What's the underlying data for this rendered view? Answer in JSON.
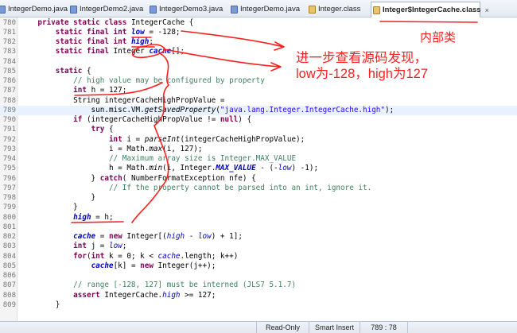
{
  "tabs": [
    {
      "label": "IntegerDemo.java",
      "type": "java",
      "active": false
    },
    {
      "label": "IntegerDemo2.java",
      "type": "java",
      "active": false
    },
    {
      "label": "IntegerDemo3.java",
      "type": "java",
      "active": false
    },
    {
      "label": "IntegerDemo.java",
      "type": "java",
      "active": false
    },
    {
      "label": "Integer.class",
      "type": "class",
      "active": false
    },
    {
      "label": "Integer$IntegerCache.class",
      "type": "class",
      "active": true
    }
  ],
  "tab_close_glyph": "×",
  "code_lines": [
    {
      "num": "780",
      "html": "    <span class=\"k\">private static class</span> IntegerCache {"
    },
    {
      "num": "781",
      "html": "        <span class=\"k\">static final int</span> <span class=\"fb\">low</span> = -128;"
    },
    {
      "num": "782",
      "html": "        <span class=\"k\">static final int</span> <span class=\"fb\">high</span>;"
    },
    {
      "num": "783",
      "html": "        <span class=\"k\">static final</span> Integer <span class=\"fb\">cache</span>[];"
    },
    {
      "num": "784",
      "html": ""
    },
    {
      "num": "785",
      "html": "        <span class=\"k\">static</span> {"
    },
    {
      "num": "786",
      "html": "            <span class=\"c\">// high value may be configured by property</span>"
    },
    {
      "num": "787",
      "html": "            <span class=\"k\">int</span> h = 127;"
    },
    {
      "num": "788",
      "html": "            String integerCacheHighPropValue ="
    },
    {
      "num": "789",
      "html": "                sun.misc.VM.<span class=\"i\">getSavedProperty</span>(<span class=\"s\">\"java.lang.Integer.IntegerCache.high\"</span>);",
      "highlight": true
    },
    {
      "num": "790",
      "html": "            <span class=\"k\">if</span> (integerCacheHighPropValue != <span class=\"k\">null</span>) {"
    },
    {
      "num": "791",
      "html": "                <span class=\"k\">try</span> {"
    },
    {
      "num": "792",
      "html": "                    <span class=\"k\">int</span> i = <span class=\"i\">parseInt</span>(integerCacheHighPropValue);"
    },
    {
      "num": "793",
      "html": "                    i = Math.<span class=\"i\">max</span>(i, 127);"
    },
    {
      "num": "794",
      "html": "                    <span class=\"c\">// Maximum array size is Integer.MAX_VALUE</span>"
    },
    {
      "num": "795",
      "html": "                    h = Math.<span class=\"i\">min</span>(i, Integer.<span class=\"fb\">MAX_VALUE</span> - (-<span class=\"fi\">low</span>) -1);"
    },
    {
      "num": "796",
      "html": "                } <span class=\"k\">catch</span>( NumberFormatException nfe) {"
    },
    {
      "num": "797",
      "html": "                    <span class=\"c\">// If the property cannot be parsed into an int, ignore it.</span>"
    },
    {
      "num": "798",
      "html": "                }"
    },
    {
      "num": "799",
      "html": "            }"
    },
    {
      "num": "800",
      "html": "            <span class=\"fb\">high</span> = h;"
    },
    {
      "num": "801",
      "html": ""
    },
    {
      "num": "802",
      "html": "            <span class=\"fb\">cache</span> = <span class=\"k\">new</span> Integer[(<span class=\"fi\">high</span> - <span class=\"fi\">low</span>) + 1];"
    },
    {
      "num": "803",
      "html": "            <span class=\"k\">int</span> j = <span class=\"fi\">low</span>;"
    },
    {
      "num": "804",
      "html": "            <span class=\"k\">for</span>(<span class=\"k\">int</span> k = 0; k &lt; <span class=\"fi\">cache</span>.length; k++)"
    },
    {
      "num": "805",
      "html": "                <span class=\"fb\">cache</span>[k] = <span class=\"k\">new</span> Integer(j++);"
    },
    {
      "num": "806",
      "html": ""
    },
    {
      "num": "807",
      "html": "            <span class=\"c\">// range [-128, 127] must be interned (JLS7 5.1.7)</span>"
    },
    {
      "num": "808",
      "html": "            <span class=\"k\">assert</span> IntegerCache.<span class=\"fi\">high</span> &gt;= 127;"
    },
    {
      "num": "809",
      "html": "        }"
    }
  ],
  "annotations": {
    "inner_class": "内部类",
    "line1": "进一步查看源码发现，",
    "line2": "low为-128，high为127",
    "color": "#ff1e1e"
  },
  "status": {
    "mode": "Read-Only",
    "insert": "Smart Insert",
    "position": "789 : 78"
  },
  "colors": {
    "keyword": "#7f0055",
    "comment": "#3f7f5f",
    "string": "#2a00ff",
    "field": "#0000c0",
    "current_line": "#e8f2fe"
  }
}
